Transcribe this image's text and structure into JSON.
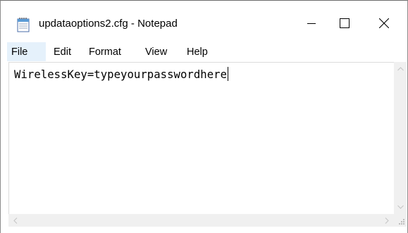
{
  "window": {
    "title": "updataoptions2.cfg - Notepad"
  },
  "menu": {
    "file": "File",
    "edit": "Edit",
    "format": "Format",
    "view": "View",
    "help": "Help"
  },
  "editor": {
    "content": "WirelessKey=typeyourpasswordhere"
  },
  "icons": {
    "app": "notepad-icon",
    "minimize": "minimize-icon",
    "maximize": "maximize-icon",
    "close": "close-icon"
  },
  "colors": {
    "menu_highlight": "#e5f1fb",
    "scrollbar_track": "#f0f0f0"
  }
}
